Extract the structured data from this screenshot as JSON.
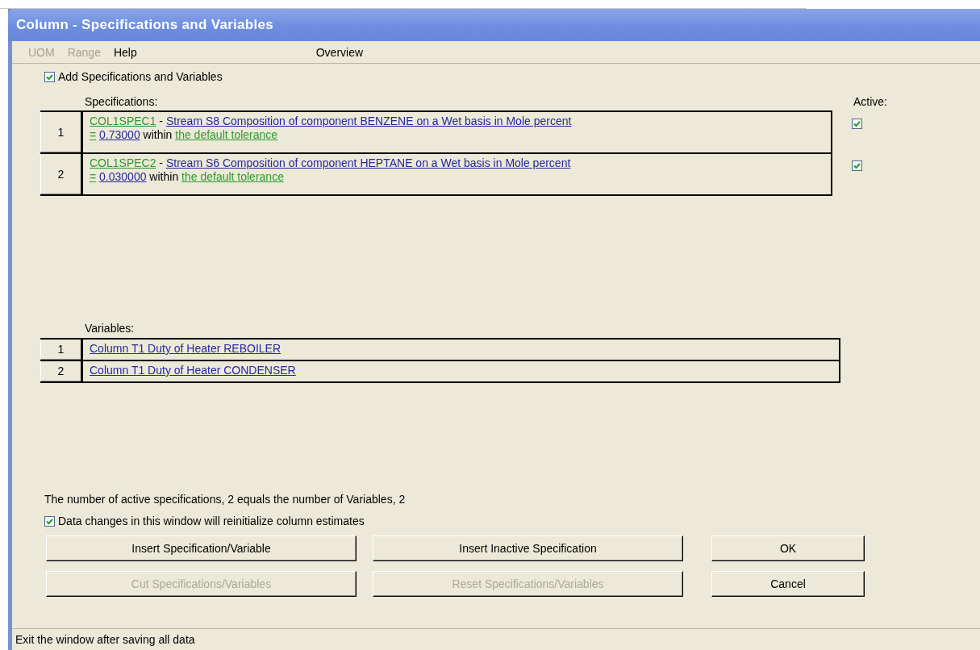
{
  "window": {
    "title": "Column - Specifications and Variables"
  },
  "menu": [
    {
      "label": "UOM",
      "disabled": true
    },
    {
      "label": "Range",
      "disabled": true
    },
    {
      "label": "Help",
      "disabled": false
    },
    {
      "label": "Overview",
      "disabled": false
    }
  ],
  "add_option": {
    "label": "Add Specifications and Variables",
    "checked": true
  },
  "specifications": {
    "label": "Specifications:",
    "active_label": "Active:",
    "rows": [
      {
        "number": "1",
        "name": "COL1SPEC1",
        "separator": "-",
        "description": "Stream S8 Composition of component BENZENE on a Wet basis in Mole percent",
        "operator": "=",
        "value": "0.73000",
        "connector": "within",
        "tolerance": "the default tolerance",
        "active": true
      },
      {
        "number": "2",
        "name": "COL1SPEC2",
        "separator": "-",
        "description": "Stream S6 Composition of component HEPTANE on a Wet basis in Mole percent",
        "operator": "=",
        "value": "0.030000",
        "connector": "within",
        "tolerance": "the default tolerance",
        "active": true
      }
    ]
  },
  "variables": {
    "label": "Variables:",
    "rows": [
      {
        "number": "1",
        "text": "Column T1 Duty of Heater REBOILER"
      },
      {
        "number": "2",
        "text": "Column T1 Duty of Heater CONDENSER"
      }
    ]
  },
  "summary": "The number of active specifications, 2 equals the number of Variables, 2",
  "reinit_option": {
    "label": "Data changes in this window will reinitialize column estimates",
    "checked": true
  },
  "buttons": [
    {
      "label": "Insert Specification/Variable",
      "disabled": false
    },
    {
      "label": "Insert Inactive Specification",
      "disabled": false
    },
    {
      "label": "OK",
      "disabled": false
    },
    {
      "label": "Cut Specifications/Variables",
      "disabled": true
    },
    {
      "label": "Reset Specifications/Variables",
      "disabled": true
    },
    {
      "label": "Cancel",
      "disabled": false
    }
  ],
  "status_bar": "Exit the window after saving all data"
}
